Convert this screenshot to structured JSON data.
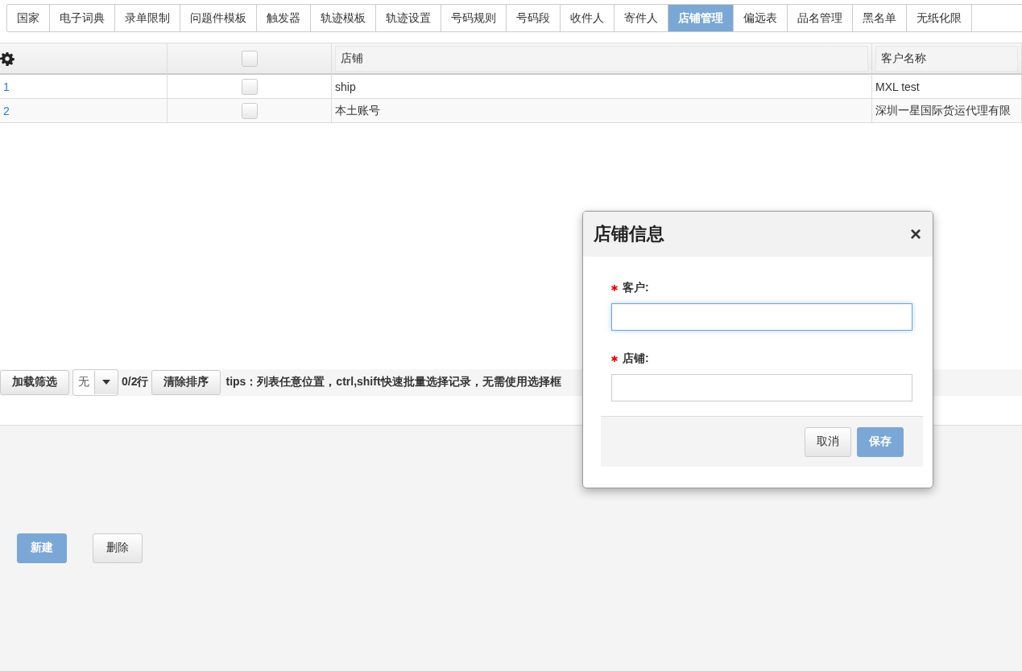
{
  "tabs": [
    {
      "label": "国家",
      "selected": false
    },
    {
      "label": "电子词典",
      "selected": false
    },
    {
      "label": "录单限制",
      "selected": false
    },
    {
      "label": "问题件模板",
      "selected": false
    },
    {
      "label": "触发器",
      "selected": false
    },
    {
      "label": "轨迹模板",
      "selected": false
    },
    {
      "label": "轨迹设置",
      "selected": false
    },
    {
      "label": "号码规则",
      "selected": false
    },
    {
      "label": "号码段",
      "selected": false
    },
    {
      "label": "收件人",
      "selected": false
    },
    {
      "label": "寄件人",
      "selected": false
    },
    {
      "label": "店铺管理",
      "selected": true
    },
    {
      "label": "偏远表",
      "selected": false
    },
    {
      "label": "品名管理",
      "selected": false
    },
    {
      "label": "黑名单",
      "selected": false
    },
    {
      "label": "无纸化限",
      "selected": false
    }
  ],
  "table": {
    "columns": [
      "店铺",
      "客户名称"
    ],
    "header_checked": false,
    "rows": [
      {
        "index": "1",
        "checked": false,
        "cells": [
          "ship",
          "MXL test"
        ]
      },
      {
        "index": "2",
        "checked": false,
        "cells": [
          "本土账号",
          "深圳一星国际货运代理有限"
        ]
      }
    ]
  },
  "toolbar": {
    "load_filter": "加载筛选",
    "select_value": "无",
    "count": "0/2行",
    "clear_sort": "清除排序",
    "tips": "tips：列表任意位置，ctrl,shift快速批量选择记录，无需使用选择框"
  },
  "footer_buttons": [
    {
      "label": "新建",
      "kind": "primary"
    },
    {
      "label": "删除",
      "kind": "default"
    }
  ],
  "dialog": {
    "title": "店铺信息",
    "close": "×",
    "fields": [
      {
        "label": "客户:",
        "required": true,
        "focused": true
      },
      {
        "label": "店铺:",
        "required": true,
        "focused": false
      }
    ],
    "buttons": [
      {
        "label": "取消",
        "kind": "default"
      },
      {
        "label": "保存",
        "kind": "primary"
      }
    ]
  }
}
